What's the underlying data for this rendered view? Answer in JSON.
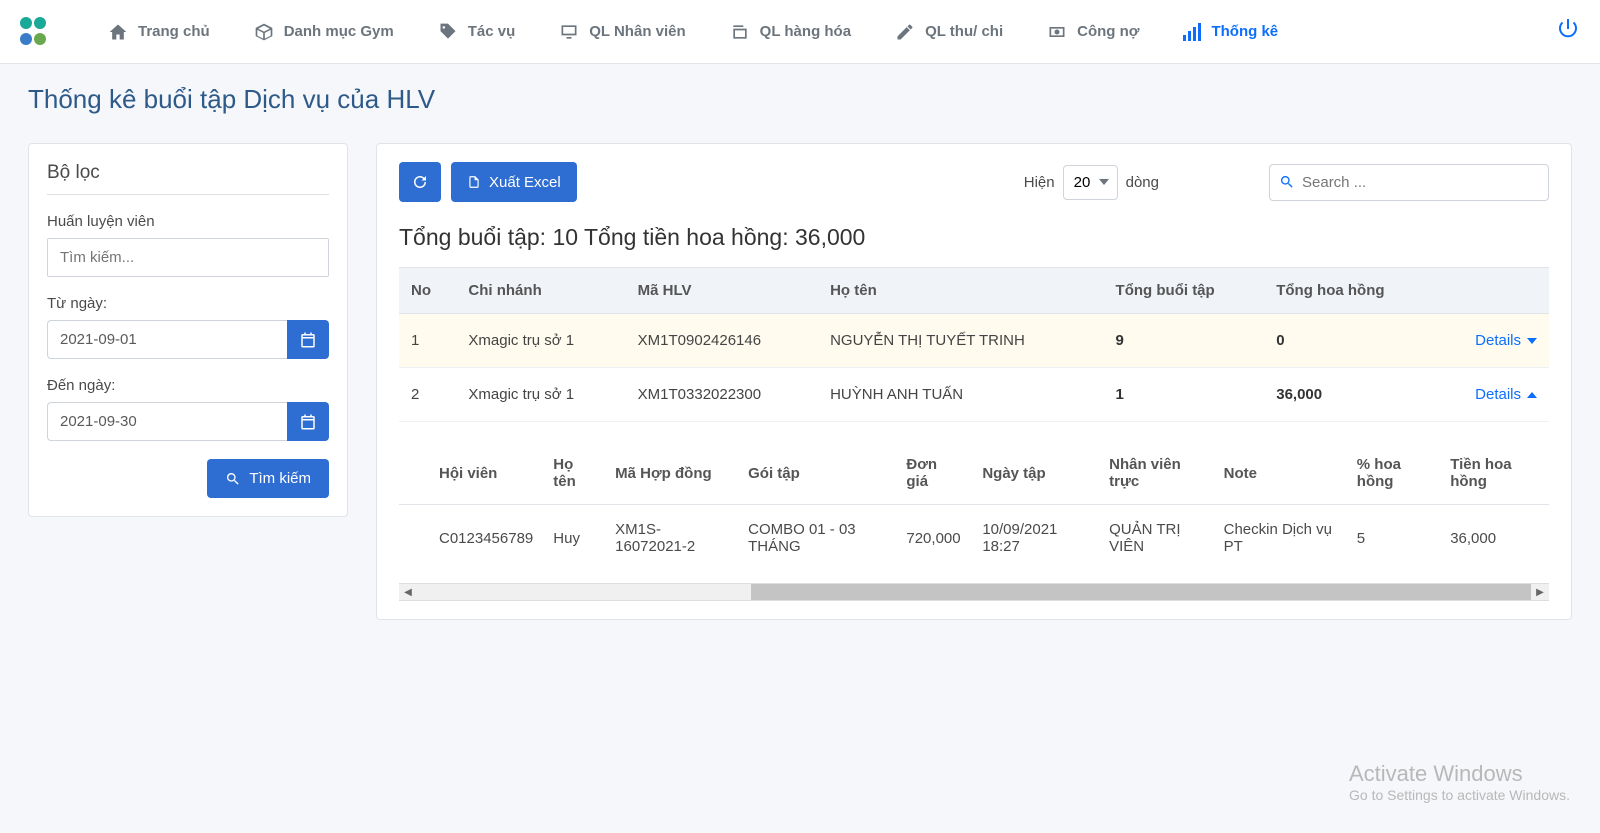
{
  "nav": {
    "items": [
      {
        "label": "Trang chủ"
      },
      {
        "label": "Danh mục Gym"
      },
      {
        "label": "Tác vụ"
      },
      {
        "label": "QL Nhân viên"
      },
      {
        "label": "QL hàng hóa"
      },
      {
        "label": "QL thu/ chi"
      },
      {
        "label": "Công nợ"
      },
      {
        "label": "Thống kê"
      }
    ]
  },
  "page_title": "Thống kê buổi tập Dịch vụ của HLV",
  "filter": {
    "title": "Bộ lọc",
    "trainer_label": "Huấn luyện viên",
    "trainer_placeholder": "Tìm kiếm...",
    "from_label": "Từ ngày:",
    "from_value": "2021-09-01",
    "to_label": "Đến ngày:",
    "to_value": "2021-09-30",
    "search_btn": "Tìm kiếm"
  },
  "toolbar": {
    "export_label": "Xuất Excel",
    "show_prefix": "Hiện",
    "rows_value": "20",
    "show_suffix": "dòng",
    "search_placeholder": "Search ..."
  },
  "summary": {
    "text": "Tổng buổi tập: 10 Tổng tiền hoa hồng: 36,000"
  },
  "table": {
    "headers": {
      "no": "No",
      "branch": "Chi nhánh",
      "code": "Mã HLV",
      "name": "Họ tên",
      "sessions": "Tổng buổi tập",
      "commission": "Tổng hoa hồng"
    },
    "rows": [
      {
        "no": "1",
        "branch": "Xmagic trụ sở 1",
        "code": "XM1T0902426146",
        "name": "NGUYỄN THỊ TUYẾT TRINH",
        "sessions": "9",
        "commission": "0",
        "details": "Details"
      },
      {
        "no": "2",
        "branch": "Xmagic trụ sở 1",
        "code": "XM1T0332022300",
        "name": "HUỲNH ANH TUẤN",
        "sessions": "1",
        "commission": "36,000",
        "details": "Details"
      }
    ]
  },
  "detail": {
    "headers": {
      "member": "Hội viên",
      "fullname": "Họ tên",
      "contract": "Mã Hợp đồng",
      "package": "Gói tập",
      "price": "Đơn giá",
      "date": "Ngày tập",
      "staff": "Nhân viên trực",
      "note": "Note",
      "percent": "% hoa hồng",
      "amount": "Tiền hoa hồng"
    },
    "row": {
      "member": "C0123456789",
      "fullname": "Huy",
      "contract": "XM1S-16072021-2",
      "package": "COMBO 01 - 03 THÁNG",
      "price": "720,000",
      "date": "10/09/2021 18:27",
      "staff": "QUẢN TRỊ VIÊN",
      "note": "Checkin Dịch vụ PT",
      "percent": "5",
      "amount": "36,000"
    }
  },
  "watermark": {
    "line1": "Activate Windows",
    "line2": "Go to Settings to activate Windows."
  }
}
